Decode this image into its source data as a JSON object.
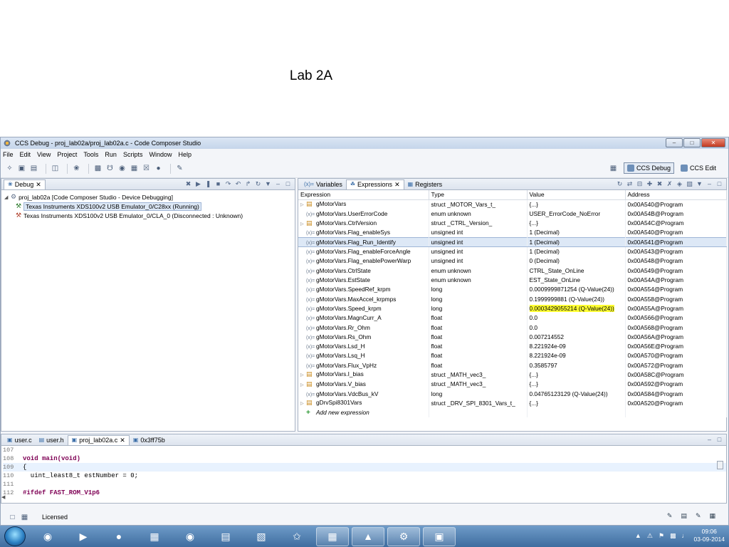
{
  "slide": {
    "title": "Lab 2A"
  },
  "window": {
    "title": "CCS Debug - proj_lab02a/proj_lab02a.c - Code Composer Studio",
    "buttons": {
      "minimize": "–",
      "maximize": "□",
      "close": "✕"
    }
  },
  "menu": [
    "File",
    "Edit",
    "View",
    "Project",
    "Tools",
    "Run",
    "Scripts",
    "Window",
    "Help"
  ],
  "perspectives": {
    "debug": "CCS Debug",
    "edit": "CCS Edit"
  },
  "debug_view": {
    "tab": "Debug",
    "tree": [
      {
        "label": "proj_lab02a [Code Composer Studio - Device Debugging]"
      },
      {
        "label": "Texas Instruments XDS100v2 USB Emulator_0/C28xx (Running)"
      },
      {
        "label": "Texas Instruments XDS100v2 USB Emulator_0/CLA_0 (Disconnected : Unknown)"
      }
    ]
  },
  "expressions_view": {
    "tabs": [
      "Variables",
      "Expressions",
      "Registers"
    ],
    "columns": [
      "Expression",
      "Type",
      "Value",
      "Address"
    ],
    "rows": [
      {
        "expr": "gMotorVars",
        "type": "struct _MOTOR_Vars_t_",
        "value": "{...}",
        "addr": "0x00A540@Program",
        "kind": "struct"
      },
      {
        "expr": "gMotorVars.UserErrorCode",
        "type": "enum unknown",
        "value": "USER_ErrorCode_NoError",
        "addr": "0x00A54B@Program",
        "kind": "var"
      },
      {
        "expr": "gMotorVars.CtrlVersion",
        "type": "struct _CTRL_Version_",
        "value": "{...}",
        "addr": "0x00A54C@Program",
        "kind": "struct"
      },
      {
        "expr": "gMotorVars.Flag_enableSys",
        "type": "unsigned int",
        "value": "1 (Decimal)",
        "addr": "0x00A540@Program",
        "kind": "var"
      },
      {
        "expr": "gMotorVars.Flag_Run_Identify",
        "type": "unsigned int",
        "value": "1 (Decimal)",
        "addr": "0x00A541@Program",
        "kind": "var"
      },
      {
        "expr": "gMotorVars.Flag_enableForceAngle",
        "type": "unsigned int",
        "value": "1 (Decimal)",
        "addr": "0x00A543@Program",
        "kind": "var"
      },
      {
        "expr": "gMotorVars.Flag_enablePowerWarp",
        "type": "unsigned int",
        "value": "0 (Decimal)",
        "addr": "0x00A548@Program",
        "kind": "var"
      },
      {
        "expr": "gMotorVars.CtrlState",
        "type": "enum unknown",
        "value": "CTRL_State_OnLine",
        "addr": "0x00A549@Program",
        "kind": "var"
      },
      {
        "expr": "gMotorVars.EstState",
        "type": "enum unknown",
        "value": "EST_State_OnLine",
        "addr": "0x00A54A@Program",
        "kind": "var"
      },
      {
        "expr": "gMotorVars.SpeedRef_krpm",
        "type": "long",
        "value": "0.0009999871254 (Q-Value(24))",
        "addr": "0x00A554@Program",
        "kind": "var"
      },
      {
        "expr": "gMotorVars.MaxAccel_krpmps",
        "type": "long",
        "value": "0.1999999881 (Q-Value(24))",
        "addr": "0x00A558@Program",
        "kind": "var"
      },
      {
        "expr": "gMotorVars.Speed_krpm",
        "type": "long",
        "value": "0.0003429055214 (Q-Value(24))",
        "addr": "0x00A55A@Program",
        "kind": "var"
      },
      {
        "expr": "gMotorVars.MagnCurr_A",
        "type": "float",
        "value": "0.0",
        "addr": "0x00A566@Program",
        "kind": "var"
      },
      {
        "expr": "gMotorVars.Rr_Ohm",
        "type": "float",
        "value": "0.0",
        "addr": "0x00A568@Program",
        "kind": "var"
      },
      {
        "expr": "gMotorVars.Rs_Ohm",
        "type": "float",
        "value": "0.007214552",
        "addr": "0x00A56A@Program",
        "kind": "var"
      },
      {
        "expr": "gMotorVars.Lsd_H",
        "type": "float",
        "value": "8.221924e-09",
        "addr": "0x00A56E@Program",
        "kind": "var"
      },
      {
        "expr": "gMotorVars.Lsq_H",
        "type": "float",
        "value": "8.221924e-09",
        "addr": "0x00A570@Program",
        "kind": "var"
      },
      {
        "expr": "gMotorVars.Flux_VpHz",
        "type": "float",
        "value": "0.3585797",
        "addr": "0x00A572@Program",
        "kind": "var"
      },
      {
        "expr": "gMotorVars.I_bias",
        "type": "struct _MATH_vec3_",
        "value": "{...}",
        "addr": "0x00A58C@Program",
        "kind": "struct"
      },
      {
        "expr": "gMotorVars.V_bias",
        "type": "struct _MATH_vec3_",
        "value": "{...}",
        "addr": "0x00A592@Program",
        "kind": "struct"
      },
      {
        "expr": "gMotorVars.VdcBus_kV",
        "type": "long",
        "value": "0.04765123129 (Q-Value(24))",
        "addr": "0x00A584@Program",
        "kind": "var"
      },
      {
        "expr": "gDrvSpi8301Vars",
        "type": "struct _DRV_SPI_8301_Vars_t_",
        "value": "{...}",
        "addr": "0x00A520@Program",
        "kind": "struct"
      }
    ],
    "add_new": "Add new expression"
  },
  "editor": {
    "tabs": [
      "user.c",
      "user.h",
      "proj_lab02a.c",
      "0x3ff75b"
    ],
    "lines": [
      {
        "num": "107",
        "code": ""
      },
      {
        "num": "108",
        "code": "void main(void)"
      },
      {
        "num": "109",
        "code": "{"
      },
      {
        "num": "110",
        "code": "  uint_least8_t estNumber = 0;"
      },
      {
        "num": "111",
        "code": ""
      },
      {
        "num": "112",
        "code": "#ifdef FAST_ROM_V1p6"
      }
    ]
  },
  "status": {
    "text": "Licensed"
  },
  "taskbar": {
    "time": "09:06",
    "date": "03-09-2014"
  }
}
